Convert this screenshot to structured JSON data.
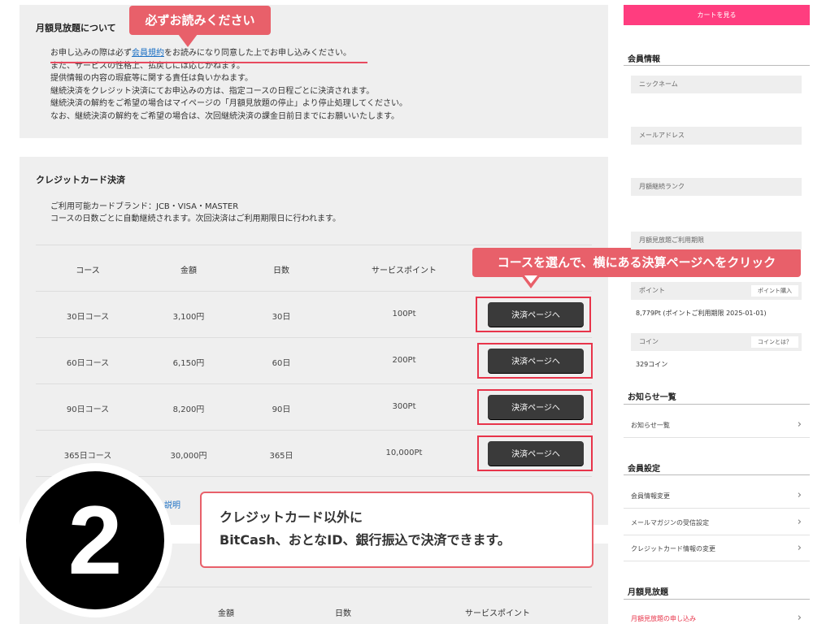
{
  "notice": {
    "title": "月額見放題について",
    "callout": "必ずお読みください",
    "line1_pre": "お申し込みの際は必ず",
    "line1_link": "会員規約",
    "line1_post": "をお読みになり同意した上でお申し込みください。",
    "lines": [
      "また、サービスの性格上、払戻しには応じかねます。",
      "提供情報の内容の瑕疵等に関する責任は負いかねます。",
      "継続決済をクレジット決済にてお申込みの方は、指定コースの日程ごとに決済されます。",
      "継続決済の解約をご希望の場合はマイページの「月額見放題の停止」より停止処理してください。",
      "なお、継続決済の解約をご希望の場合は、次回継続決済の課金日前日までにお願いいたします。"
    ]
  },
  "credit": {
    "title": "クレジットカード決済",
    "brands": "ご利用可能カードブランド：JCB・VISA・MASTER",
    "renew": "コースの日数ごとに自動継続されます。次回決済はご利用期限日に行われます。",
    "callout": "コースを選んで、横にある決算ページへをクリック",
    "headers": {
      "course": "コース",
      "price": "金額",
      "days": "日数",
      "points": "サービスポイント"
    },
    "rows": [
      {
        "course": "30日コース",
        "price": "3,100円",
        "days": "30日",
        "points": "100Pt",
        "button": "決済ページへ"
      },
      {
        "course": "60日コース",
        "price": "6,150円",
        "days": "60日",
        "points": "200Pt",
        "button": "決済ページへ"
      },
      {
        "course": "90日コース",
        "price": "8,200円",
        "days": "90日",
        "points": "300Pt",
        "button": "決済ページへ"
      },
      {
        "course": "365日コース",
        "price": "30,000円",
        "days": "365日",
        "points": "10,000Pt",
        "button": "決済ページへ"
      }
    ],
    "explain_link": "説明"
  },
  "info_box": {
    "line1": "クレジットカード以外に",
    "line2": "BitCash、おとなID、銀行振込で決済できます。"
  },
  "step_number": "2",
  "lower_headers": {
    "price": "金額",
    "days": "日数",
    "points": "サービスポイント"
  },
  "sidebar": {
    "cart_button": "カートを見る",
    "member_info": {
      "title": "会員情報",
      "nickname": "ニックネーム",
      "email": "メールアドレス",
      "rank": "月額継続ランク",
      "period": "月額見放題ご利用期限",
      "point_label": "ポイント",
      "point_button": "ポイント購入",
      "point_value": "8,779Pt (ポイントご利用期限 2025-01-01)",
      "coin_label": "コイン",
      "coin_button": "コインとは？",
      "coin_value": "329コイン"
    },
    "news": {
      "title": "お知らせ一覧",
      "items": [
        "お知らせ一覧"
      ]
    },
    "settings": {
      "title": "会員設定",
      "items": [
        "会員情報変更",
        "メールマガジンの受信設定",
        "クレジットカード情報の変更"
      ]
    },
    "unlimited": {
      "title": "月額見放題",
      "items": [
        "月額見放題の申し込み"
      ]
    }
  }
}
